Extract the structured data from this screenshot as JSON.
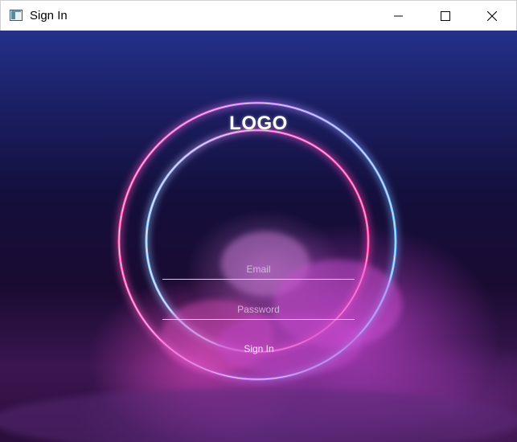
{
  "window": {
    "title": "Sign In",
    "app_icon": "window-app-icon",
    "controls": {
      "minimize": "minimize-icon",
      "maximize": "maximize-icon",
      "close": "close-icon"
    }
  },
  "form": {
    "logo": "LOGO",
    "email_placeholder": "Email",
    "password_placeholder": "Password",
    "signin_label": "Sign In"
  },
  "colors": {
    "outer_ring": "#6fb4ff",
    "inner_ring": "#ff3da8",
    "background_top": "#24318a",
    "smoke": "#cd46d7"
  }
}
